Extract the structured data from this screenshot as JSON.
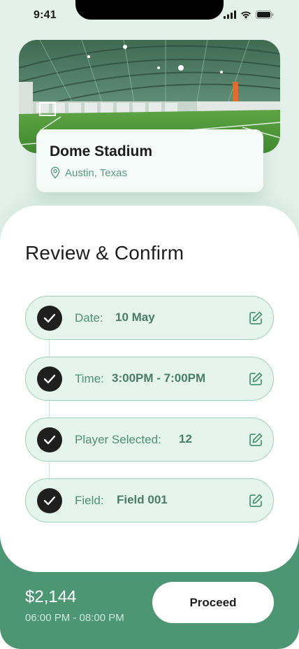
{
  "status_bar": {
    "time": "9:41"
  },
  "venue": {
    "name": "Dome Stadium",
    "location": "Austin, Texas"
  },
  "review": {
    "title": "Review & Confirm",
    "items": [
      {
        "label": "Date:",
        "value": "10 May"
      },
      {
        "label": "Time:",
        "value": "3:00PM - 7:00PM"
      },
      {
        "label": "Player Selected:",
        "value": "12"
      },
      {
        "label": "Field:",
        "value": "Field 001"
      }
    ]
  },
  "footer": {
    "price": "$2,144",
    "time_range": "06:00 PM - 08:00 PM",
    "proceed_label": "Proceed"
  },
  "colors": {
    "accent": "#4c9674",
    "background": "#e3f1ea",
    "row_bg": "#e6f4ee",
    "row_border": "#9dd0b6"
  },
  "icons": {
    "location": "map-pin-icon",
    "check": "check-circle-icon",
    "edit": "edit-icon"
  }
}
